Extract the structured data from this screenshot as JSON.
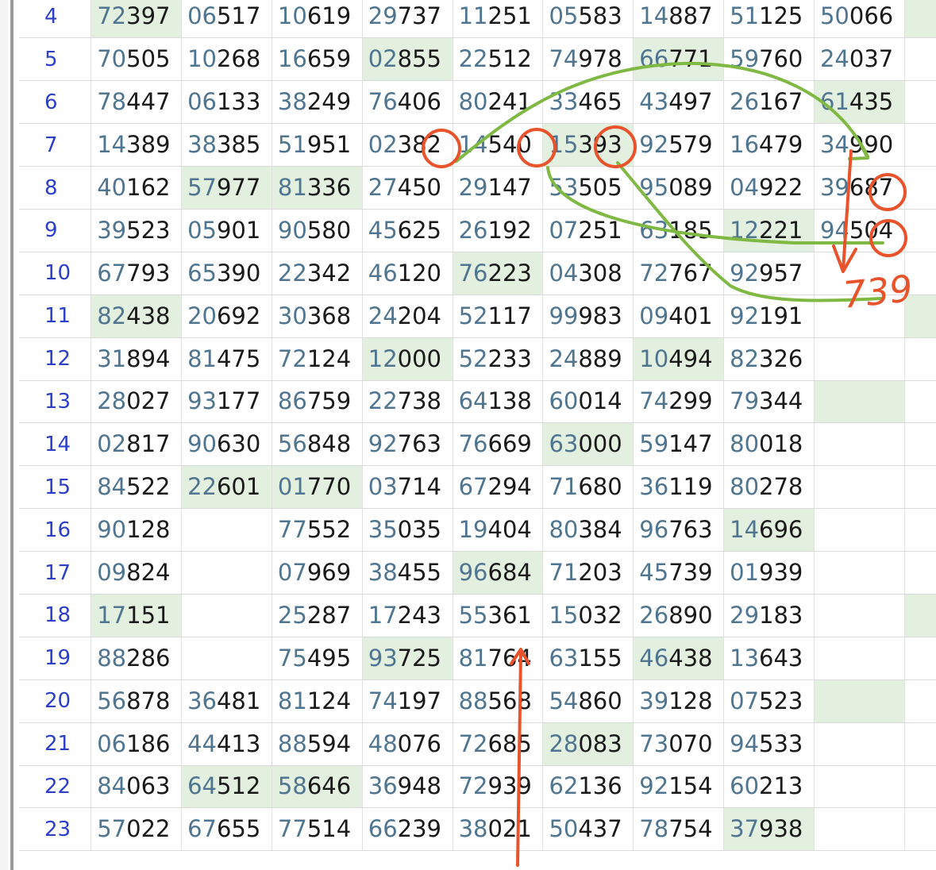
{
  "table": {
    "rows": [
      {
        "n": "4",
        "cells": [
          [
            "72",
            "397",
            true
          ],
          [
            "06",
            "517",
            false
          ],
          [
            "10",
            "619",
            false
          ],
          [
            "29",
            "737",
            false
          ],
          [
            "11",
            "251",
            false
          ],
          [
            "05",
            "583",
            false
          ],
          [
            "14",
            "887",
            false
          ],
          [
            "51",
            "125",
            false
          ],
          [
            "50",
            "066",
            false
          ]
        ],
        "edge": true
      },
      {
        "n": "5",
        "cells": [
          [
            "70",
            "505",
            false
          ],
          [
            "10",
            "268",
            false
          ],
          [
            "16",
            "659",
            false
          ],
          [
            "02",
            "855",
            true
          ],
          [
            "22",
            "512",
            false
          ],
          [
            "74",
            "978",
            false
          ],
          [
            "66",
            "771",
            true
          ],
          [
            "59",
            "760",
            false
          ],
          [
            "24",
            "037",
            false
          ]
        ],
        "edge": false
      },
      {
        "n": "6",
        "cells": [
          [
            "78",
            "447",
            false
          ],
          [
            "06",
            "133",
            false
          ],
          [
            "38",
            "249",
            false
          ],
          [
            "76",
            "406",
            false
          ],
          [
            "80",
            "241",
            false
          ],
          [
            "33",
            "465",
            false
          ],
          [
            "43",
            "497",
            false
          ],
          [
            "26",
            "167",
            false
          ],
          [
            "61",
            "435",
            true
          ]
        ],
        "edge": false
      },
      {
        "n": "7",
        "cells": [
          [
            "14",
            "389",
            false
          ],
          [
            "38",
            "385",
            false
          ],
          [
            "51",
            "951",
            false
          ],
          [
            "02",
            "382",
            false
          ],
          [
            "14",
            "540",
            false
          ],
          [
            "15",
            "393",
            true
          ],
          [
            "92",
            "579",
            false
          ],
          [
            "16",
            "479",
            false
          ],
          [
            "34",
            "990",
            false
          ]
        ],
        "edge": false
      },
      {
        "n": "8",
        "cells": [
          [
            "40",
            "162",
            false
          ],
          [
            "57",
            "977",
            true
          ],
          [
            "81",
            "336",
            true
          ],
          [
            "27",
            "450",
            false
          ],
          [
            "29",
            "147",
            false
          ],
          [
            "53",
            "505",
            false
          ],
          [
            "95",
            "089",
            false
          ],
          [
            "04",
            "922",
            false
          ],
          [
            "39",
            "687",
            false
          ]
        ],
        "edge": false
      },
      {
        "n": "9",
        "cells": [
          [
            "39",
            "523",
            false
          ],
          [
            "05",
            "901",
            false
          ],
          [
            "90",
            "580",
            false
          ],
          [
            "45",
            "625",
            false
          ],
          [
            "26",
            "192",
            false
          ],
          [
            "07",
            "251",
            false
          ],
          [
            "63",
            "185",
            false
          ],
          [
            "12",
            "221",
            true
          ],
          [
            "94",
            "504",
            false
          ]
        ],
        "edge": false
      },
      {
        "n": "10",
        "cells": [
          [
            "67",
            "793",
            false
          ],
          [
            "65",
            "390",
            false
          ],
          [
            "22",
            "342",
            false
          ],
          [
            "46",
            "120",
            false
          ],
          [
            "76",
            "223",
            true
          ],
          [
            "04",
            "308",
            false
          ],
          [
            "72",
            "767",
            false
          ],
          [
            "92",
            "957",
            false
          ],
          [
            "",
            "",
            " false"
          ]
        ],
        "edge": false
      },
      {
        "n": "11",
        "cells": [
          [
            "82",
            "438",
            true
          ],
          [
            "20",
            "692",
            false
          ],
          [
            "30",
            "368",
            false
          ],
          [
            "24",
            "204",
            false
          ],
          [
            "52",
            "117",
            false
          ],
          [
            "99",
            "983",
            false
          ],
          [
            "09",
            "401",
            false
          ],
          [
            "92",
            "191",
            false
          ],
          [
            "",
            "",
            false
          ]
        ],
        "edge": true
      },
      {
        "n": "12",
        "cells": [
          [
            "31",
            "894",
            false
          ],
          [
            "81",
            "475",
            false
          ],
          [
            "72",
            "124",
            false
          ],
          [
            "12",
            "000",
            true
          ],
          [
            "52",
            "233",
            false
          ],
          [
            "24",
            "889",
            false
          ],
          [
            "10",
            "494",
            true
          ],
          [
            "82",
            "326",
            false
          ],
          [
            "",
            "",
            false
          ]
        ],
        "edge": false
      },
      {
        "n": "13",
        "cells": [
          [
            "28",
            "027",
            false
          ],
          [
            "93",
            "177",
            false
          ],
          [
            "86",
            "759",
            false
          ],
          [
            "22",
            "738",
            false
          ],
          [
            "64",
            "138",
            false
          ],
          [
            "60",
            "014",
            false
          ],
          [
            "74",
            "299",
            false
          ],
          [
            "79",
            "344",
            false
          ],
          [
            "",
            "",
            true
          ]
        ],
        "edge": false
      },
      {
        "n": "14",
        "cells": [
          [
            "02",
            "817",
            false
          ],
          [
            "90",
            "630",
            false
          ],
          [
            "56",
            "848",
            false
          ],
          [
            "92",
            "763",
            false
          ],
          [
            "76",
            "669",
            false
          ],
          [
            "63",
            "000",
            true
          ],
          [
            "59",
            "147",
            false
          ],
          [
            "80",
            "018",
            false
          ],
          [
            "",
            "",
            false
          ]
        ],
        "edge": false
      },
      {
        "n": "15",
        "cells": [
          [
            "84",
            "522",
            false
          ],
          [
            "22",
            "601",
            true
          ],
          [
            "01",
            "770",
            true
          ],
          [
            "03",
            "714",
            false
          ],
          [
            "67",
            "294",
            false
          ],
          [
            "71",
            "680",
            false
          ],
          [
            "36",
            "119",
            false
          ],
          [
            "80",
            "278",
            false
          ],
          [
            "",
            "",
            false
          ]
        ],
        "edge": false
      },
      {
        "n": "16",
        "cells": [
          [
            "90",
            "128",
            false
          ],
          [
            "",
            "",
            false
          ],
          [
            "77",
            "552",
            false
          ],
          [
            "35",
            "035",
            false
          ],
          [
            "19",
            "404",
            false
          ],
          [
            "80",
            "384",
            false
          ],
          [
            "96",
            "763",
            false
          ],
          [
            "14",
            "696",
            true
          ],
          [
            "",
            "",
            false
          ]
        ],
        "edge": false
      },
      {
        "n": "17",
        "cells": [
          [
            "09",
            "824",
            false
          ],
          [
            "",
            "",
            false
          ],
          [
            "07",
            "969",
            false
          ],
          [
            "38",
            "455",
            false
          ],
          [
            "96",
            "684",
            true
          ],
          [
            "71",
            "203",
            false
          ],
          [
            "45",
            "739",
            false
          ],
          [
            "01",
            "939",
            false
          ],
          [
            "",
            "",
            false
          ]
        ],
        "edge": false
      },
      {
        "n": "18",
        "cells": [
          [
            "17",
            "151",
            true
          ],
          [
            "",
            "",
            false
          ],
          [
            "25",
            "287",
            false
          ],
          [
            "17",
            "243",
            false
          ],
          [
            "55",
            "361",
            false
          ],
          [
            "15",
            "032",
            false
          ],
          [
            "26",
            "890",
            false
          ],
          [
            "29",
            "183",
            false
          ],
          [
            "",
            "",
            false
          ]
        ],
        "edge": true
      },
      {
        "n": "19",
        "cells": [
          [
            "88",
            "286",
            false
          ],
          [
            "",
            "",
            false
          ],
          [
            "75",
            "495",
            false
          ],
          [
            "93",
            "725",
            true
          ],
          [
            "81",
            "764",
            false
          ],
          [
            "63",
            "155",
            false
          ],
          [
            "46",
            "438",
            true
          ],
          [
            "13",
            "643",
            false
          ],
          [
            "",
            "",
            false
          ]
        ],
        "edge": false
      },
      {
        "n": "20",
        "cells": [
          [
            "56",
            "878",
            false
          ],
          [
            "36",
            "481",
            false
          ],
          [
            "81",
            "124",
            false
          ],
          [
            "74",
            "197",
            false
          ],
          [
            "88",
            "568",
            false
          ],
          [
            "54",
            "860",
            false
          ],
          [
            "39",
            "128",
            false
          ],
          [
            "07",
            "523",
            false
          ],
          [
            "",
            "",
            true
          ]
        ],
        "edge": false
      },
      {
        "n": "21",
        "cells": [
          [
            "06",
            "186",
            false
          ],
          [
            "44",
            "413",
            false
          ],
          [
            "88",
            "594",
            false
          ],
          [
            "48",
            "076",
            false
          ],
          [
            "72",
            "685",
            false
          ],
          [
            "28",
            "083",
            true
          ],
          [
            "73",
            "070",
            false
          ],
          [
            "94",
            "533",
            false
          ],
          [
            "",
            "",
            false
          ]
        ],
        "edge": false
      },
      {
        "n": "22",
        "cells": [
          [
            "84",
            "063",
            false
          ],
          [
            "64",
            "512",
            true
          ],
          [
            "58",
            "646",
            true
          ],
          [
            "36",
            "948",
            false
          ],
          [
            "72",
            "939",
            false
          ],
          [
            "62",
            "136",
            false
          ],
          [
            "92",
            "154",
            false
          ],
          [
            "60",
            "213",
            false
          ],
          [
            "",
            "",
            false
          ]
        ],
        "edge": false
      },
      {
        "n": "23",
        "cells": [
          [
            "57",
            "022",
            false
          ],
          [
            "67",
            "655",
            false
          ],
          [
            "77",
            "514",
            false
          ],
          [
            "66",
            "239",
            false
          ],
          [
            "38",
            "021",
            false
          ],
          [
            "50",
            "437",
            false
          ],
          [
            "78",
            "754",
            false
          ],
          [
            "37",
            "938",
            true
          ],
          [
            "",
            "",
            false
          ]
        ],
        "edge": false
      }
    ]
  },
  "annotations": {
    "handwritten_number": "739",
    "ink_colors": {
      "red": "#e8532b",
      "green": "#7fb843"
    }
  },
  "colors": {
    "highlight_bg": "#e3efdf",
    "row_number": "#2b3fc8",
    "prefix_digits": "#4f7590",
    "suffix_digits": "#1a1a1a"
  }
}
